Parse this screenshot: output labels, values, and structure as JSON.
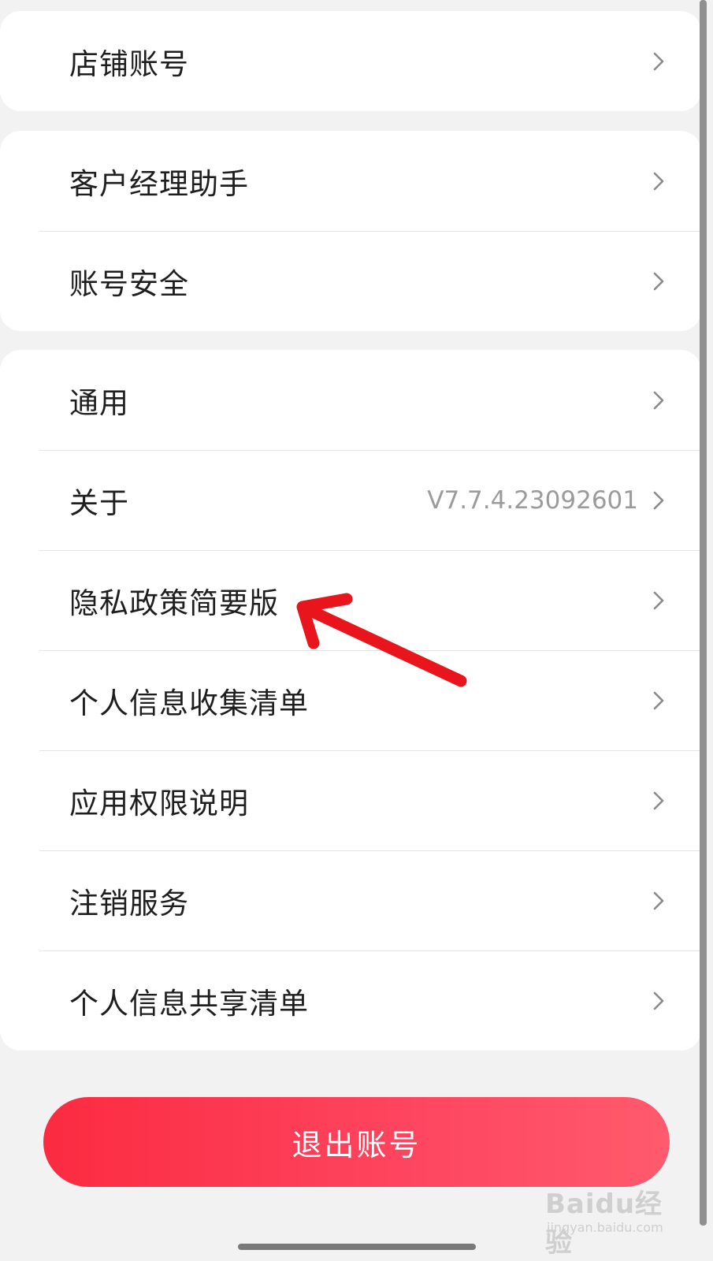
{
  "groups": [
    {
      "items": [
        {
          "label": "店铺账号"
        }
      ]
    },
    {
      "items": [
        {
          "label": "客户经理助手"
        },
        {
          "label": "账号安全"
        }
      ]
    },
    {
      "items": [
        {
          "label": "通用"
        },
        {
          "label": "关于",
          "value": "V7.7.4.23092601"
        },
        {
          "label": "隐私政策简要版"
        },
        {
          "label": "个人信息收集清单"
        },
        {
          "label": "应用权限说明"
        },
        {
          "label": "注销服务"
        },
        {
          "label": "个人信息共享清单"
        }
      ]
    }
  ],
  "logout": {
    "label": "退出账号"
  },
  "watermark": {
    "brand": "Baidu经验",
    "url": "jingyan.baidu.com"
  },
  "icons": {
    "row": "chevron-right-icon",
    "annotation": "red-arrow-icon"
  },
  "colors": {
    "background": "#f2f2f2",
    "card": "#ffffff",
    "accent": "#fb2b41",
    "accent_end": "#ff5a6d",
    "annotation": "#e8161c",
    "secondary_text": "#9b9b9b"
  }
}
